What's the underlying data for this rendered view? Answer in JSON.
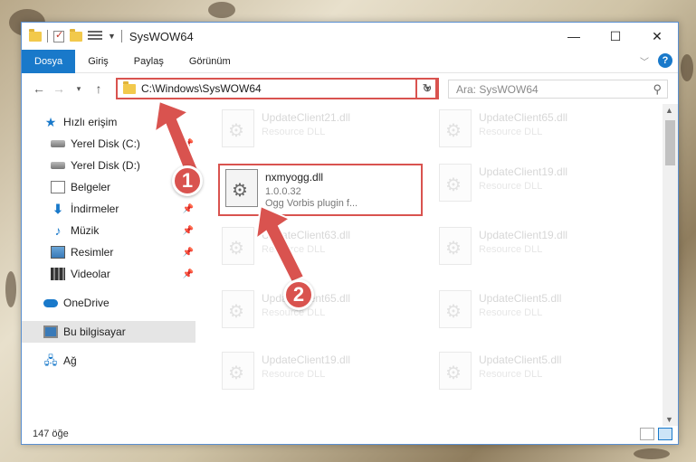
{
  "window": {
    "title": "SysWOW64"
  },
  "ribbon": {
    "tabs": [
      "Dosya",
      "Giriş",
      "Paylaş",
      "Görünüm"
    ]
  },
  "navigation": {
    "address": "C:\\Windows\\SysWOW64",
    "search_placeholder": "Ara: SysWOW64"
  },
  "sidebar": {
    "items": [
      {
        "label": "Hızlı erişim",
        "icon": "star-icon"
      },
      {
        "label": "Yerel Disk (C:)",
        "icon": "drive-icon"
      },
      {
        "label": "Yerel Disk (D:)",
        "icon": "drive-icon"
      },
      {
        "label": "Belgeler",
        "icon": "documents-icon"
      },
      {
        "label": "İndirmeler",
        "icon": "download-icon"
      },
      {
        "label": "Müzik",
        "icon": "music-icon"
      },
      {
        "label": "Resimler",
        "icon": "pictures-icon"
      },
      {
        "label": "Videolar",
        "icon": "videos-icon"
      },
      {
        "label": "OneDrive",
        "icon": "cloud-icon"
      },
      {
        "label": "Bu bilgisayar",
        "icon": "pc-icon"
      },
      {
        "label": "Ağ",
        "icon": "network-icon"
      }
    ]
  },
  "files": [
    {
      "name": "UpdateClient21.dll",
      "sub": "Resource DLL"
    },
    {
      "name": "UpdateClient65.dll",
      "sub": "Resource DLL"
    },
    {
      "name": "nxmyogg.dll",
      "sub": "1.0.0.32",
      "sub2": "Ogg Vorbis plugin f..."
    },
    {
      "name": "UpdateClient19.dll",
      "sub": "Resource DLL"
    },
    {
      "name": "UpdateClient63.dll",
      "sub": "Resource DLL"
    },
    {
      "name": "UpdateClient19.dll",
      "sub": "Resource DLL"
    },
    {
      "name": "UpdateClient65.dll",
      "sub": "Resource DLL"
    },
    {
      "name": "UpdateClient5.dll",
      "sub": "Resource DLL"
    },
    {
      "name": "UpdateClient19.dll",
      "sub": "Resource DLL"
    },
    {
      "name": "UpdateClient5.dll",
      "sub": "Resource DLL"
    }
  ],
  "status": {
    "count": "147 öğe"
  },
  "annotations": [
    "1",
    "2"
  ],
  "colors": {
    "accent": "#1979ca",
    "highlight": "#d9534f"
  }
}
